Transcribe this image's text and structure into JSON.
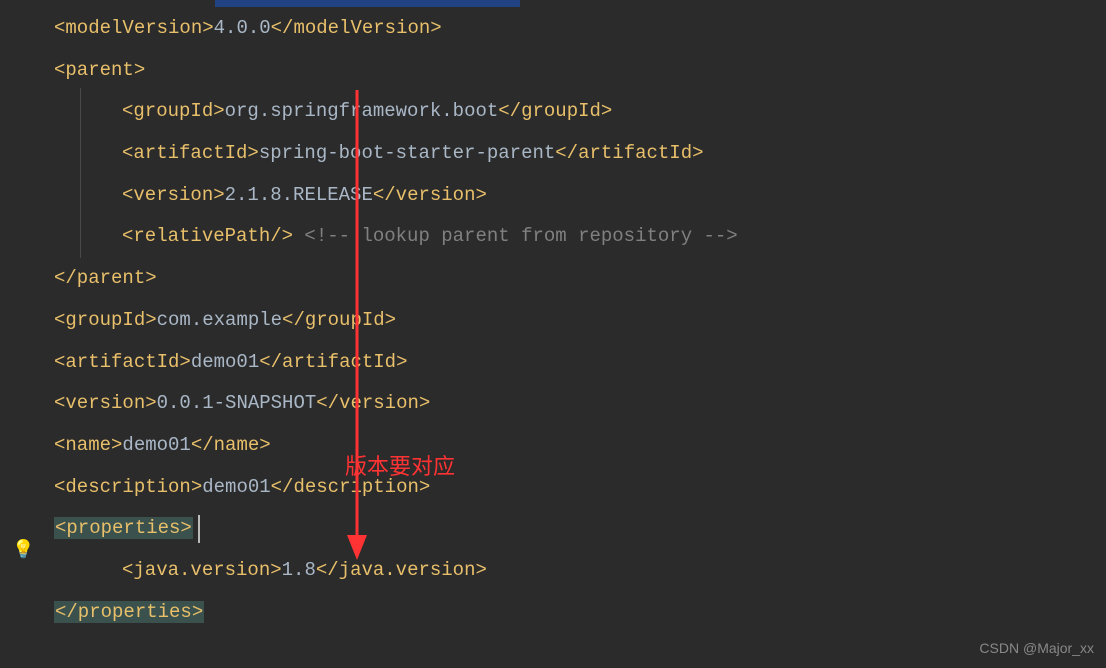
{
  "lines": {
    "modelVersion_open": "<modelVersion>",
    "modelVersion_text": "4.0.0",
    "modelVersion_close": "</modelVersion>",
    "parent_open": "<parent>",
    "groupId_open": "<groupId>",
    "parent_groupId_text": "org.springframework.boot",
    "groupId_close": "</groupId>",
    "artifactId_open": "<artifactId>",
    "parent_artifactId_text": "spring-boot-starter-parent",
    "artifactId_close": "</artifactId>",
    "version_open": "<version>",
    "parent_version_text": "2.1.8.RELEASE",
    "version_close": "</version>",
    "relativePath": "<relativePath/>",
    "relativePath_comment": " <!-- lookup parent from repository -->",
    "parent_close": "</parent>",
    "proj_groupId_text": "com.example",
    "proj_artifactId_text": "demo01",
    "proj_version_text": "0.0.1-SNAPSHOT",
    "name_open": "<name>",
    "name_text": "demo01",
    "name_close": "</name>",
    "description_open": "<description>",
    "description_text": "demo01",
    "description_close": "</description>",
    "properties_open": "<properties>",
    "javaversion_open": "<java.version>",
    "javaversion_text": "1.8",
    "javaversion_close": "</java.version>",
    "properties_close": "</properties>"
  },
  "annotation": "版本要对应",
  "watermark": "CSDN @Major_xx",
  "bulb": "💡"
}
